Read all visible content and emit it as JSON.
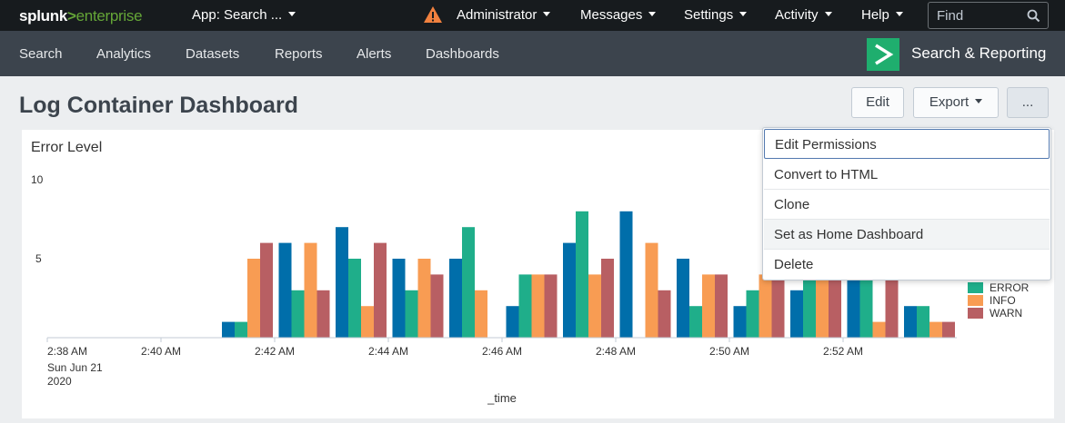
{
  "topbar": {
    "logo_brand": "splunk",
    "logo_arrow": ">",
    "logo_product": "enterprise",
    "app_select": "App: Search ...",
    "nav": [
      {
        "label": "Administrator"
      },
      {
        "label": "Messages"
      },
      {
        "label": "Settings"
      },
      {
        "label": "Activity"
      },
      {
        "label": "Help"
      }
    ],
    "find_placeholder": "Find",
    "warning_icon": "warning-triangle-icon",
    "warning_color": "#f1813f"
  },
  "appbar": {
    "nav": [
      {
        "label": "Search"
      },
      {
        "label": "Analytics"
      },
      {
        "label": "Datasets"
      },
      {
        "label": "Reports"
      },
      {
        "label": "Alerts"
      },
      {
        "label": "Dashboards"
      }
    ],
    "app_title": "Search & Reporting",
    "app_logo_color": "#1fae6e"
  },
  "dashboard": {
    "title": "Log Container Dashboard",
    "edit_label": "Edit",
    "export_label": "Export",
    "more_label": "..."
  },
  "panel": {
    "title": "Error Level"
  },
  "menu": {
    "items": [
      {
        "label": "Edit Permissions"
      },
      {
        "label": "Convert to HTML"
      },
      {
        "label": "Clone"
      },
      {
        "label": "Set as Home Dashboard"
      },
      {
        "label": "Delete"
      }
    ]
  },
  "chart_data": {
    "type": "bar",
    "title": "Error Level",
    "xlabel": "_time",
    "ylabel": "",
    "ylim": [
      0,
      10
    ],
    "y_ticks": [
      "5",
      "10"
    ],
    "x_ticks": [
      "2:38 AM",
      "2:40 AM",
      "2:42 AM",
      "2:44 AM",
      "2:46 AM",
      "2:48 AM",
      "2:50 AM",
      "2:52 AM"
    ],
    "x_date_line1": "Sun Jun 21",
    "x_date_line2": "2020",
    "categories": [
      "2:38",
      "2:39",
      "2:40",
      "2:41",
      "2:42",
      "2:43",
      "2:44",
      "2:45",
      "2:46",
      "2:47",
      "2:48",
      "2:49",
      "2:50",
      "2:51",
      "2:52",
      "2:53"
    ],
    "series": [
      {
        "name": "",
        "color": "#006eaa",
        "values": [
          0,
          0,
          0,
          1,
          6,
          7,
          5,
          5,
          2,
          6,
          8,
          5,
          2,
          3,
          6,
          2
        ]
      },
      {
        "name": "ERROR",
        "color": "#1fae8a",
        "values": [
          0,
          0,
          0,
          1,
          3,
          5,
          3,
          7,
          4,
          8,
          0,
          2,
          3,
          5,
          5,
          2
        ]
      },
      {
        "name": "INFO",
        "color": "#f89c53",
        "values": [
          0,
          0,
          0,
          5,
          6,
          2,
          5,
          3,
          4,
          4,
          6,
          4,
          4,
          6,
          1,
          1
        ]
      },
      {
        "name": "WARN",
        "color": "#b85f63",
        "values": [
          0,
          0,
          0,
          6,
          3,
          6,
          4,
          0,
          4,
          5,
          3,
          4,
          5,
          5,
          4,
          1
        ]
      }
    ],
    "legend_position": "right",
    "grid": false
  }
}
